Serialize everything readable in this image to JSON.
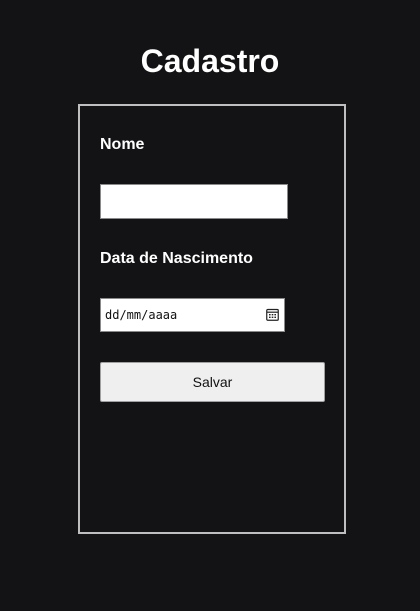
{
  "page": {
    "title": "Cadastro"
  },
  "form": {
    "name_label": "Nome",
    "name_value": "",
    "birthdate_label": "Data de Nascimento",
    "birthdate_placeholder": "dd/mm/aaaa",
    "submit_label": "Salvar"
  },
  "icons": {
    "date_picker": "calendar-icon"
  },
  "colors": {
    "background": "#131315",
    "card_border": "#bfbfbf",
    "text": "#ffffff",
    "button_background": "#efefef"
  }
}
